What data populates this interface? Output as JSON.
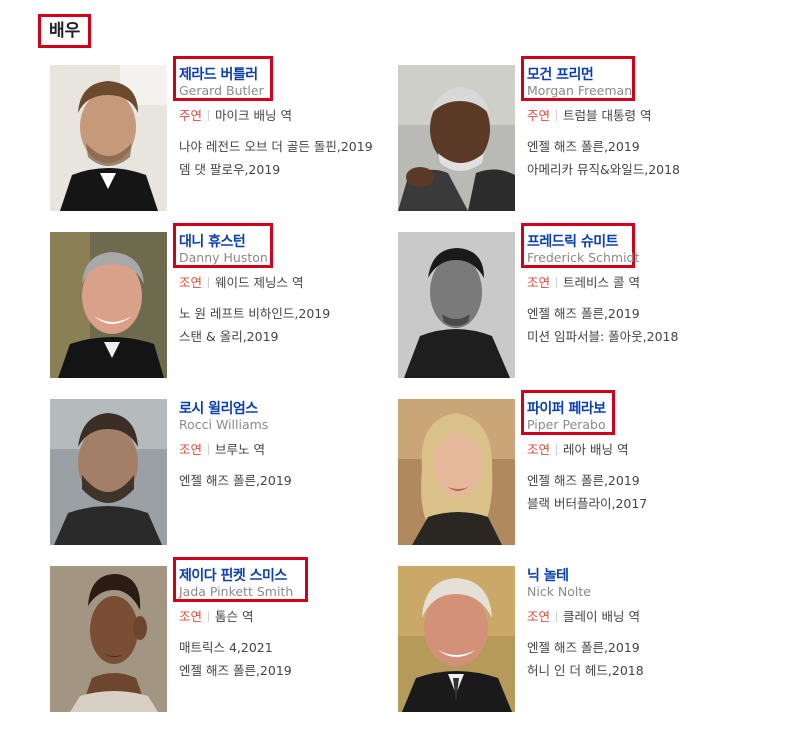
{
  "section": {
    "title": "배우"
  },
  "actors": [
    {
      "name_ko": "제라드 버틀러",
      "name_en": "Gerard Butler",
      "role_type": "주연",
      "role": "마이크 배닝 역",
      "films": [
        "나야 레전드 오브 더 골든 돌핀,2019",
        "뎀 댓 팔로우,2019"
      ]
    },
    {
      "name_ko": "모건 프리먼",
      "name_en": "Morgan Freeman",
      "role_type": "주연",
      "role": "트럼블 대통령 역",
      "films": [
        "엔젤 해즈 폴른,2019",
        "아메리카 뮤직&와일드,2018"
      ]
    },
    {
      "name_ko": "대니 휴스턴",
      "name_en": "Danny Huston",
      "role_type": "조연",
      "role": "웨이드 제닝스 역",
      "films": [
        "노 원 레프트 비하인드,2019",
        "스탠 & 올리,2019"
      ]
    },
    {
      "name_ko": "프레드릭 슈미트",
      "name_en": "Frederick Schmidt",
      "role_type": "조연",
      "role": "트레비스 콜 역",
      "films": [
        "엔젤 해즈 폴른,2019",
        "미션 임파서블: 폴아웃,2018"
      ]
    },
    {
      "name_ko": "로시 윌리엄스",
      "name_en": "Rocci Williams",
      "role_type": "조연",
      "role": "브루노 역",
      "films": [
        "엔젤 해즈 폴른,2019"
      ]
    },
    {
      "name_ko": "파이퍼 페라보",
      "name_en": "Piper Perabo",
      "role_type": "조연",
      "role": "레아 배닝 역",
      "films": [
        "엔젤 해즈 폴른,2019",
        "블랙 버터플라이,2017"
      ]
    },
    {
      "name_ko": "제이다 핀켓 스미스",
      "name_en": "Jada Pinkett Smith",
      "role_type": "조연",
      "role": "톰슨 역",
      "films": [
        "매트릭스 4,2021",
        "엔젤 해즈 폴른,2019"
      ]
    },
    {
      "name_ko": "닉 놀테",
      "name_en": "Nick Nolte",
      "role_type": "조연",
      "role": "클레이 배닝 역",
      "films": [
        "엔젤 해즈 폴른,2019",
        "허니 인 더 헤드,2018"
      ]
    }
  ],
  "colors": {
    "highlight_box": "#d0021b",
    "name_link": "#0a3fb0",
    "role_type": "#e24b3b",
    "subtext": "#8a8a8a"
  }
}
